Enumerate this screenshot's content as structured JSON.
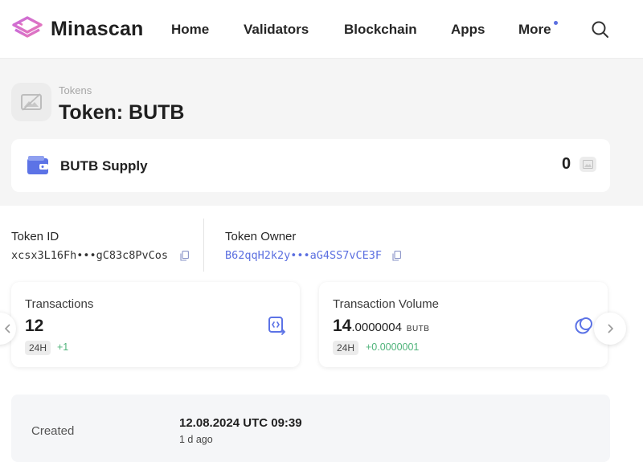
{
  "brand": {
    "name": "Minascan"
  },
  "nav": {
    "home": "Home",
    "validators": "Validators",
    "blockchain": "Blockchain",
    "apps": "Apps",
    "more": "More"
  },
  "breadcrumb": "Tokens",
  "title": "Token: BUTB",
  "supply": {
    "label": "BUTB Supply",
    "value": "0"
  },
  "token_id": {
    "label": "Token ID",
    "value": "xcsx3L16Fh•••gC83c8PvCos"
  },
  "token_owner": {
    "label": "Token Owner",
    "value": "B62qqH2k2y•••aG4SS7vCE3F"
  },
  "transactions": {
    "label": "Transactions",
    "value": "12",
    "period": "24H",
    "delta": "+1"
  },
  "volume": {
    "label": "Transaction Volume",
    "value_int": "14",
    "value_frac": ".0000004",
    "unit": "BUTB",
    "period": "24H",
    "delta": "+0.0000001"
  },
  "created": {
    "label": "Created",
    "date": "12.08.2024 UTC 09:39",
    "ago": "1 d ago"
  },
  "colors": {
    "link": "#5b6fe0",
    "positive": "#4fb37a",
    "icon": "#5c73e6"
  },
  "icons": [
    "minascan-logo-icon",
    "search-icon",
    "image-placeholder-icon",
    "wallet-icon",
    "copy-icon",
    "code-exchange-icon",
    "coins-icon",
    "chevron-left-icon",
    "chevron-right-icon"
  ]
}
